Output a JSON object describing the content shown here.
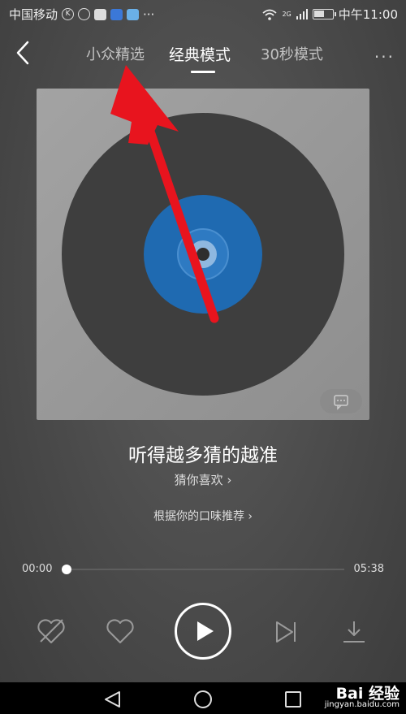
{
  "status_bar": {
    "carrier": "中国移动",
    "network": "2G",
    "time": "中午11:00",
    "dots": "···",
    "battery_level": 0.6
  },
  "header": {
    "tabs": [
      "小众精选",
      "经典模式",
      "30秒模式"
    ],
    "active_tab": "经典模式",
    "more_label": "···"
  },
  "album": {
    "icons": [
      "vinyl-record-icon",
      "comment-icon"
    ]
  },
  "song": {
    "title": "听得越多猜的越准",
    "guess_link": "猜你喜欢 ›",
    "recommend_text": "根据你的口味推荐 ›"
  },
  "progress": {
    "current_time": "00:00",
    "total_time": "05:38",
    "fraction": 0
  },
  "controls": {
    "icons": [
      "dislike-heart-icon",
      "like-heart-icon",
      "play-icon",
      "next-track-icon",
      "download-icon"
    ]
  },
  "system_nav": {
    "icons": [
      "back-triangle-icon",
      "home-circle-icon",
      "recent-square-icon"
    ]
  },
  "watermark": {
    "brand": "Bai 经验",
    "url": "jingyan.baidu.com"
  },
  "annotation": {
    "color": "#e8141e"
  }
}
